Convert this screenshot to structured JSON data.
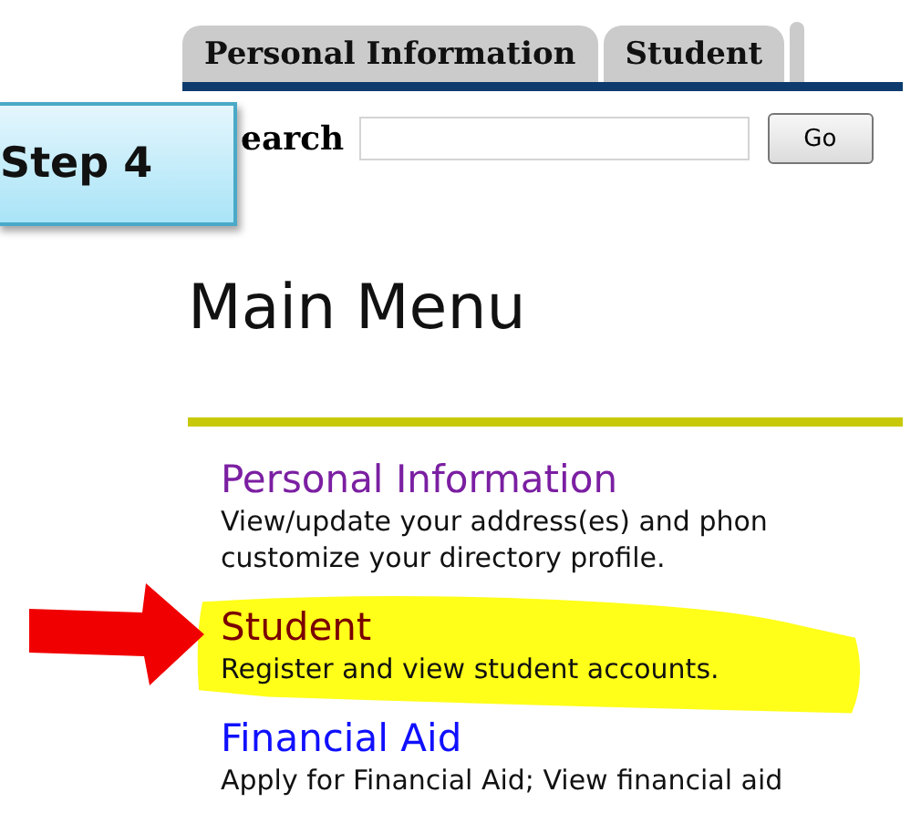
{
  "tabs": [
    {
      "label": "Personal Information"
    },
    {
      "label": "Student"
    }
  ],
  "search": {
    "label": "earch",
    "button": "Go"
  },
  "callout": {
    "text": "Step 4"
  },
  "heading": "Main Menu",
  "menu": [
    {
      "title": "Personal Information",
      "kind": "visited",
      "highlighted": false,
      "description": [
        "View/update your address(es) and phon",
        "customize your directory profile."
      ]
    },
    {
      "title": "Student",
      "kind": "active",
      "highlighted": true,
      "description": [
        "Register and view student accounts."
      ]
    },
    {
      "title": "Financial Aid",
      "kind": "link",
      "highlighted": false,
      "description": [
        "Apply for Financial Aid; View financial aid"
      ]
    }
  ]
}
